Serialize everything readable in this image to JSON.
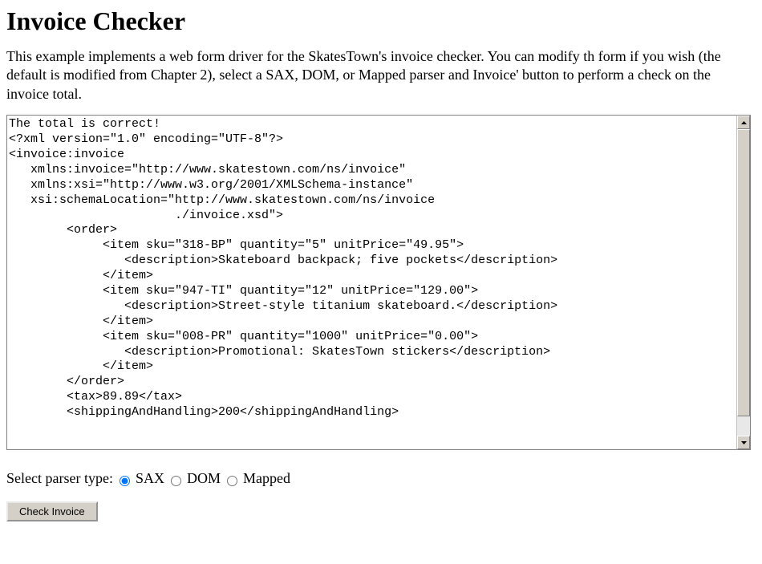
{
  "heading": "Invoice Checker",
  "intro": "This example implements a web form driver for the SkatesTown's invoice checker. You can modify th form if you wish (the default is modified from Chapter 2), select a SAX, DOM, or Mapped parser and Invoice' button to perform a check on the invoice total.",
  "textarea_content": "The total is correct!\n<?xml version=\"1.0\" encoding=\"UTF-8\"?>\n<invoice:invoice\n   xmlns:invoice=\"http://www.skatestown.com/ns/invoice\"\n   xmlns:xsi=\"http://www.w3.org/2001/XMLSchema-instance\"\n   xsi:schemaLocation=\"http://www.skatestown.com/ns/invoice\n                       ./invoice.xsd\">\n        <order>\n             <item sku=\"318-BP\" quantity=\"5\" unitPrice=\"49.95\">\n                <description>Skateboard backpack; five pockets</description>\n             </item>\n             <item sku=\"947-TI\" quantity=\"12\" unitPrice=\"129.00\">\n                <description>Street-style titanium skateboard.</description>\n             </item>\n             <item sku=\"008-PR\" quantity=\"1000\" unitPrice=\"0.00\">\n                <description>Promotional: SkatesTown stickers</description>\n             </item>\n        </order>\n        <tax>89.89</tax>\n        <shippingAndHandling>200</shippingAndHandling>",
  "parser": {
    "label": "Select parser type:",
    "options": {
      "sax": "SAX",
      "dom": "DOM",
      "mapped": "Mapped"
    },
    "selected": "sax"
  },
  "button_label": "Check Invoice"
}
